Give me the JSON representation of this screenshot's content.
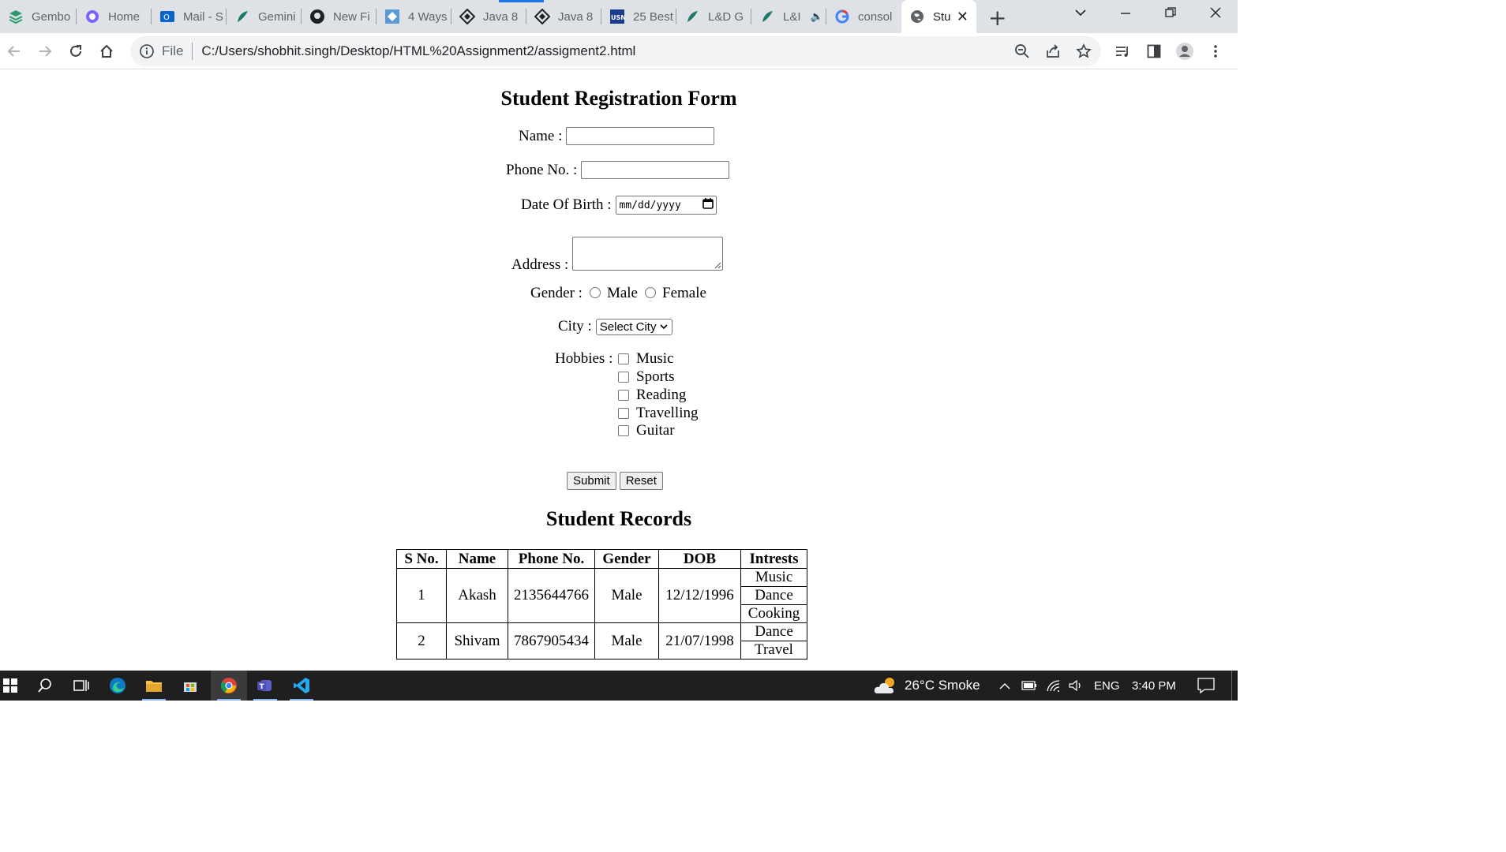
{
  "browser": {
    "tabs": [
      {
        "label": "Gembo",
        "icon": "stack-icon"
      },
      {
        "label": "Home",
        "icon": "copilot-icon"
      },
      {
        "label": "Mail - S",
        "icon": "outlook-icon"
      },
      {
        "label": "Gemini",
        "icon": "feather-icon"
      },
      {
        "label": "New Fi",
        "icon": "github-icon"
      },
      {
        "label": "4 Ways",
        "icon": "diamond-icon"
      },
      {
        "label": "Java 8",
        "icon": "diamond-outline-icon"
      },
      {
        "label": "Java 8",
        "icon": "diamond-outline-icon"
      },
      {
        "label": "25 Best",
        "icon": "usn-icon"
      },
      {
        "label": "L&D G",
        "icon": "feather-icon"
      },
      {
        "label": "L&I",
        "icon": "feather-icon"
      },
      {
        "label": "consol",
        "icon": "google-icon"
      },
      {
        "label": "Stu",
        "icon": "globe-icon"
      }
    ],
    "omnibox": {
      "scheme_label": "File",
      "url": "C:/Users/shobhit.singh/Desktop/HTML%20Assignment2/assigment2.html"
    }
  },
  "form": {
    "title": "Student Registration Form",
    "name_label": "Name :",
    "phone_label": "Phone No. :",
    "dob_label": "Date Of Birth :",
    "dob_placeholder": "mm/dd/yyyy",
    "address_label": "Address :",
    "gender_label": "Gender :",
    "gender_options": [
      "Male",
      "Female"
    ],
    "city_label": "City :",
    "city_selected": "Select City",
    "hobbies_label": "Hobbies :",
    "hobbies": [
      "Music",
      "Sports",
      "Reading",
      "Travelling",
      "Guitar"
    ],
    "submit_label": "Submit",
    "reset_label": "Reset"
  },
  "records": {
    "title": "Student Records",
    "headers": [
      "S No.",
      "Name",
      "Phone No.",
      "Gender",
      "DOB",
      "Intrests"
    ],
    "rows": [
      {
        "sno": "1",
        "name": "Akash",
        "phone": "2135644766",
        "gender": "Male",
        "dob": "12/12/1996",
        "interests": [
          "Music",
          "Dance",
          "Cooking"
        ]
      },
      {
        "sno": "2",
        "name": "Shivam",
        "phone": "7867905434",
        "gender": "Male",
        "dob": "21/07/1998",
        "interests": [
          "Dance",
          "Travel"
        ]
      }
    ]
  },
  "taskbar": {
    "weather": "26°C  Smoke",
    "language": "ENG",
    "time": "3:40 PM"
  },
  "colors": {
    "tabstrip": "#dee1e6",
    "accent": "#1a73e8",
    "taskbar": "#1f1f1f"
  }
}
